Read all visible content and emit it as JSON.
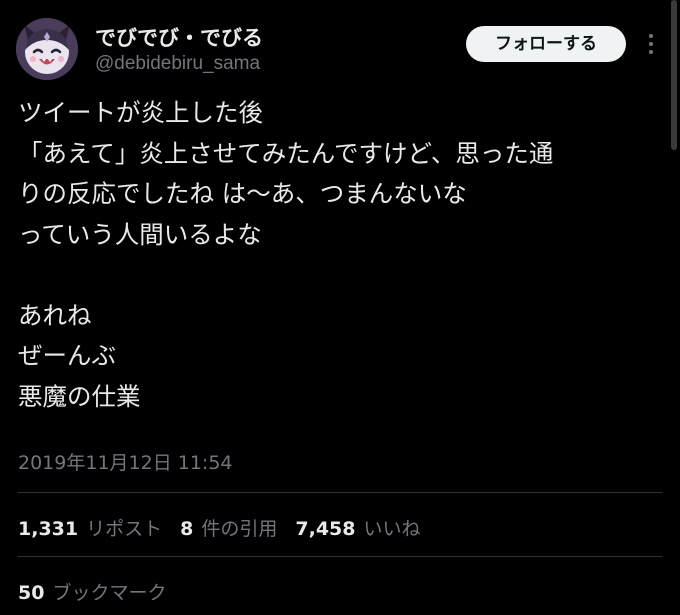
{
  "user": {
    "display_name": "でびでび・でびる",
    "handle": "@debidebiru_sama",
    "avatar_icon": "devil-avatar-icon"
  },
  "actions": {
    "follow_label": "フォローする",
    "more_icon": "more-options-icon"
  },
  "tweet": {
    "lines": [
      "ツイートが炎上した後",
      "「あえて」炎上させてみたんですけど、思った通",
      "りの反応でしたね は〜あ、つまんないな",
      "っていう人間いるよな",
      "",
      "あれね",
      "ぜーんぶ",
      "悪魔の仕業"
    ],
    "timestamp": "2019年11月12日 11:54"
  },
  "stats": {
    "reposts_count": "1,331",
    "reposts_label": "リポスト",
    "quotes_count": "8",
    "quotes_label": "件の引用",
    "likes_count": "7,458",
    "likes_label": "いいね",
    "bookmarks_count": "50",
    "bookmarks_label": "ブックマーク"
  },
  "colors": {
    "background": "#000000",
    "primary_text": "#e7e9ea",
    "secondary_text": "#71767b",
    "divider": "#2f3336",
    "follow_button_bg": "#eff3f4"
  }
}
